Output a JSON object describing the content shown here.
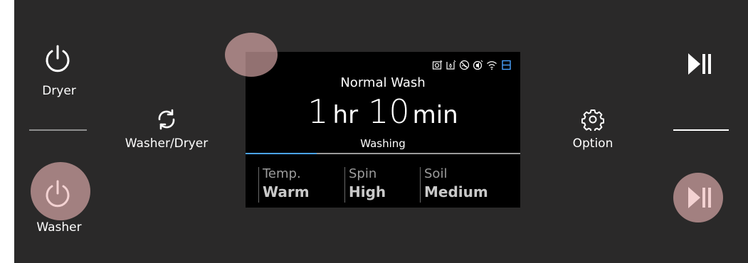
{
  "left": {
    "dryer_label": "Dryer",
    "washer_label": "Washer",
    "mode_label": "Washer/Dryer"
  },
  "right": {
    "option_label": "Option"
  },
  "display": {
    "program": "Normal Wash",
    "time_hours": "1",
    "time_hours_unit": "hr",
    "time_minutes": "10",
    "time_minutes_unit": "min",
    "status": "Washing",
    "progress": 0.26,
    "settings": [
      {
        "label": "Temp.",
        "value": "Warm"
      },
      {
        "label": "Spin",
        "value": "High"
      },
      {
        "label": "Soil",
        "value": "Medium"
      }
    ],
    "status_icons": [
      "steam-icon",
      "bubble-soak-icon",
      "no-rinse-icon",
      "sound-icon",
      "wifi-icon",
      "child-lock-icon"
    ]
  },
  "colors": {
    "panel_bg": "#2a2929",
    "screen_bg": "#000000",
    "accent_blue": "#4aa3ff",
    "touch_highlight": "#ecb6b6"
  }
}
